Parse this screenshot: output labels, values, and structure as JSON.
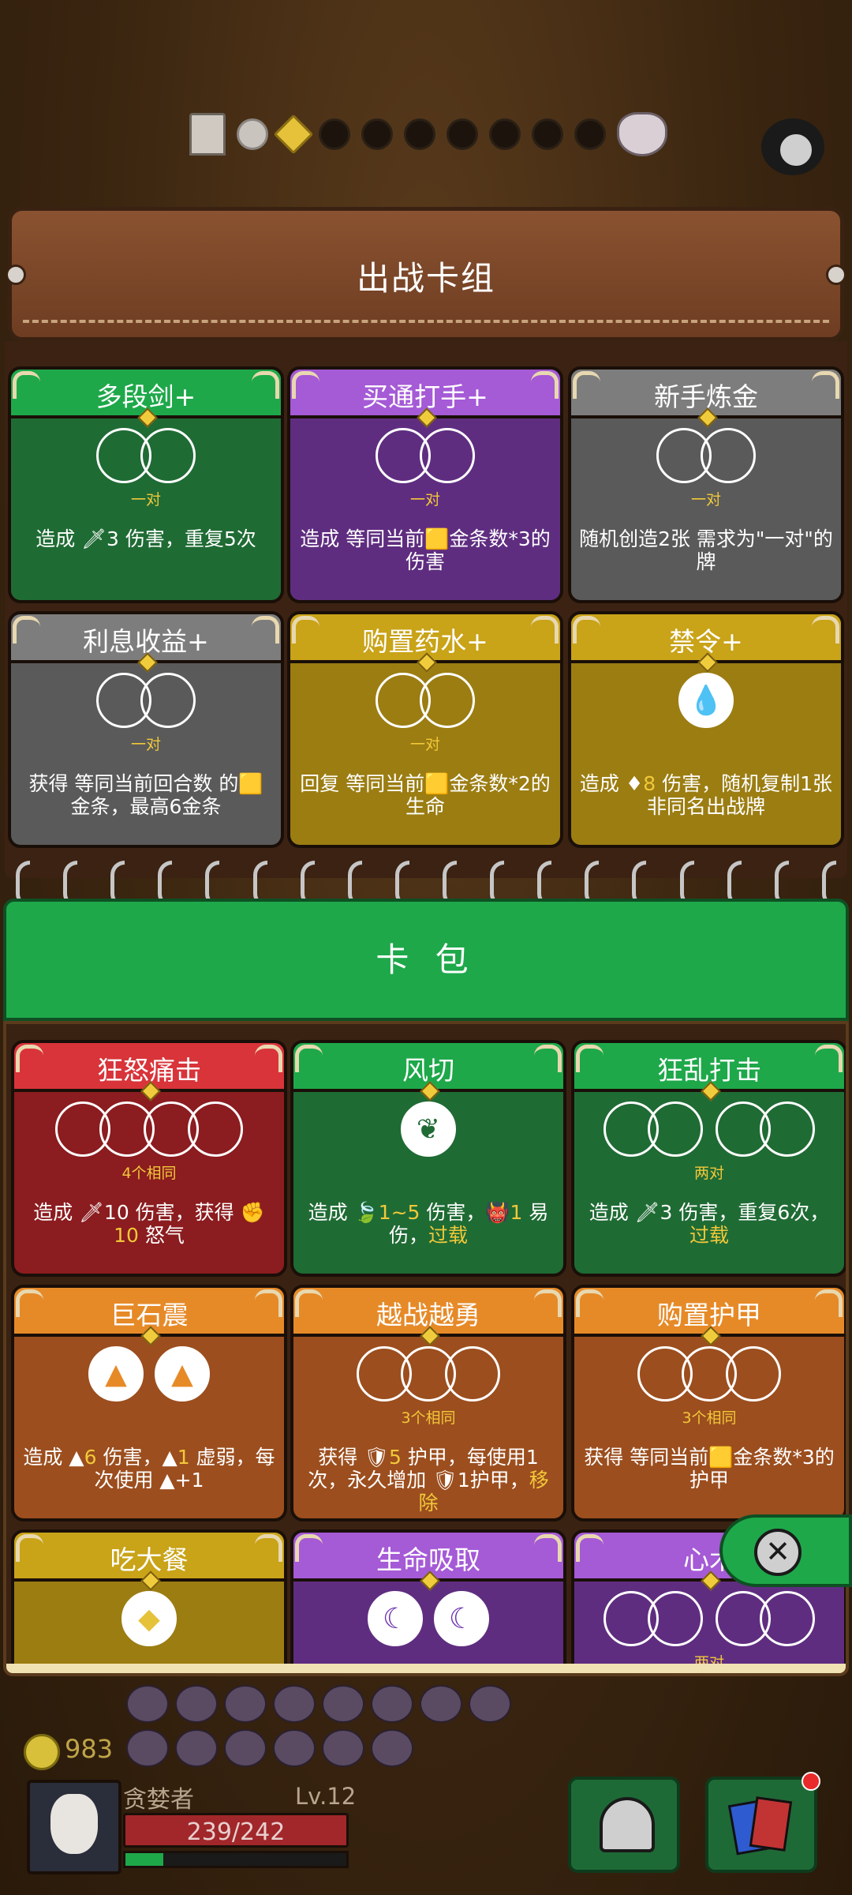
{
  "top_progress": {
    "nodes_total": 8
  },
  "deck_banner": {
    "title": "出战卡组"
  },
  "deck_cards": [
    {
      "title": "多段剑+",
      "color": "green",
      "slots": 2,
      "requirement": "一对",
      "desc_parts": [
        {
          "t": "造成 "
        },
        {
          "t": "🗡"
        },
        {
          "t": "3 伤害，重复5次"
        }
      ]
    },
    {
      "title": "买通打手+",
      "color": "purple",
      "slots": 2,
      "requirement": "一对",
      "desc_parts": [
        {
          "t": "造成 等同当前"
        },
        {
          "t": "🟨"
        },
        {
          "t": "金条数*3的伤害"
        }
      ]
    },
    {
      "title": "新手炼金",
      "color": "gray",
      "slots": 2,
      "requirement": "一对",
      "desc_parts": [
        {
          "t": "随机创造2张 需求为\"一对\"的牌"
        }
      ]
    },
    {
      "title": "利息收益+",
      "color": "gray",
      "slots": 2,
      "requirement": "一对",
      "desc_parts": [
        {
          "t": "获得 等同当前回合数 的"
        },
        {
          "t": "🟨"
        },
        {
          "t": "金条，最高6金条"
        }
      ]
    },
    {
      "title": "购置药水+",
      "color": "gold",
      "slots": 2,
      "requirement": "一对",
      "desc_parts": [
        {
          "t": "回复 等同当前"
        },
        {
          "t": "🟨"
        },
        {
          "t": "金条数*2的生命"
        }
      ]
    },
    {
      "title": "禁令+",
      "color": "gold",
      "slots": 0,
      "icon": "drop",
      "requirement": "",
      "desc_parts": [
        {
          "t": "造成 "
        },
        {
          "t": "♦"
        },
        {
          "t": "8",
          "hl": true
        },
        {
          "t": " 伤害，随机复制1张非同名出战牌"
        }
      ]
    }
  ],
  "pack_header": {
    "title": "卡 包"
  },
  "pack_cards": [
    {
      "title": "狂怒痛击",
      "color": "red",
      "slots": 4,
      "requirement": "4个相同",
      "desc_parts": [
        {
          "t": "造成 "
        },
        {
          "t": "🗡"
        },
        {
          "t": "10 伤害，获得 "
        },
        {
          "t": "✊"
        },
        {
          "t": "10",
          "hl": true
        },
        {
          "t": " 怒气"
        }
      ]
    },
    {
      "title": "风切",
      "color": "green",
      "slots": 0,
      "icon": "leaf",
      "requirement": "",
      "desc_parts": [
        {
          "t": "造成 "
        },
        {
          "t": "🍃"
        },
        {
          "t": "1~5",
          "hl": true
        },
        {
          "t": " 伤害，"
        },
        {
          "t": "👹"
        },
        {
          "t": "1",
          "hl": true
        },
        {
          "t": " 易伤，"
        },
        {
          "t": "过载",
          "hl": true
        }
      ]
    },
    {
      "title": "狂乱打击",
      "color": "green",
      "slots": 4,
      "pairs": true,
      "requirement": "两对",
      "desc_parts": [
        {
          "t": "造成 "
        },
        {
          "t": "🗡"
        },
        {
          "t": "3 伤害，重复6次，"
        },
        {
          "t": "过载",
          "hl": true
        }
      ]
    },
    {
      "title": "巨石震",
      "color": "orange",
      "slots": 0,
      "icon": "rock2",
      "requirement": "",
      "desc_parts": [
        {
          "t": "造成 "
        },
        {
          "t": "▲"
        },
        {
          "t": "6",
          "hl": true
        },
        {
          "t": " 伤害，"
        },
        {
          "t": "▲"
        },
        {
          "t": "1",
          "hl": true
        },
        {
          "t": " 虚弱，每次使用 "
        },
        {
          "t": "▲"
        },
        {
          "t": "+1"
        }
      ]
    },
    {
      "title": "越战越勇",
      "color": "orange",
      "slots": 3,
      "requirement": "3个相同",
      "desc_parts": [
        {
          "t": "获得 "
        },
        {
          "t": "🛡"
        },
        {
          "t": "5",
          "hl": true
        },
        {
          "t": " 护甲，每使用1次，永久增加 "
        },
        {
          "t": "🛡"
        },
        {
          "t": "1护甲，"
        },
        {
          "t": "移除",
          "hl": true
        }
      ]
    },
    {
      "title": "购置护甲",
      "color": "orange",
      "slots": 3,
      "requirement": "3个相同",
      "desc_parts": [
        {
          "t": "获得 等同当前"
        },
        {
          "t": "🟨"
        },
        {
          "t": "金条数*3的护甲"
        }
      ]
    },
    {
      "title": "吃大餐",
      "color": "olive",
      "slots": 0,
      "icon": "diamond",
      "requirement": "",
      "desc_parts": []
    },
    {
      "title": "生命吸取",
      "color": "purple",
      "slots": 0,
      "icon": "moon2",
      "requirement": "",
      "desc_parts": []
    },
    {
      "title": "心术",
      "color": "purple",
      "slots": 4,
      "pairs": true,
      "requirement": "两对",
      "desc_parts": []
    }
  ],
  "player": {
    "gold": "983",
    "name": "贪婪者",
    "level": "Lv.12",
    "hp_text": "239/242",
    "xp_fraction": 0.17
  },
  "colors": {
    "green": "#1ea84a",
    "purple": "#a55ad6",
    "gray": "#7d7d7d",
    "gold": "#c9a318",
    "red": "#d8343a",
    "orange": "#e68a28",
    "highlight": "#f1c83a"
  }
}
